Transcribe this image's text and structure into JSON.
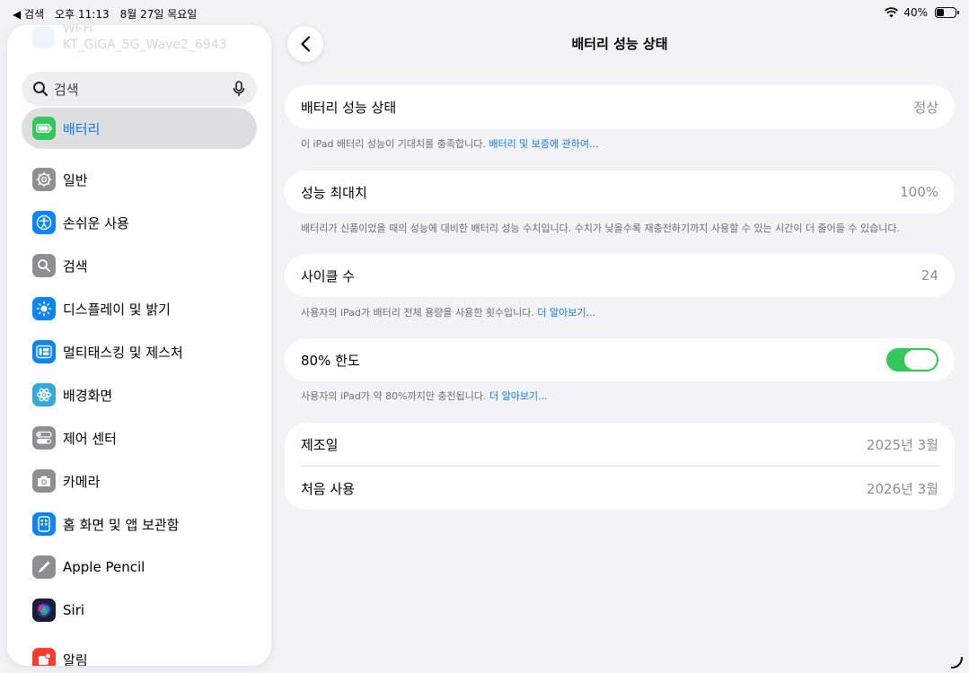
{
  "status_bar": {
    "back_app": "◀ 검색",
    "time": "오후 11:13",
    "date": "8월 27일 목요일",
    "battery_percent": "40%",
    "battery_level": 0.4
  },
  "sidebar": {
    "wifi_label": "Wi-Fi",
    "wifi_network": "KT_GiGA_5G_Wave2_6943",
    "search_placeholder": "검색",
    "selected_item": "배터리",
    "items": [
      {
        "label": "일반",
        "icon": "gear-icon",
        "color": "#8e8e93"
      },
      {
        "label": "손쉬운 사용",
        "icon": "accessibility-icon",
        "color": "#0a84ff"
      },
      {
        "label": "검색",
        "icon": "search-icon",
        "color": "#8e8e93"
      },
      {
        "label": "디스플레이 및 밝기",
        "icon": "brightness-icon",
        "color": "#0a84ff"
      },
      {
        "label": "멀티태스킹 및 제스처",
        "icon": "multitasking-icon",
        "color": "#0a84ff"
      },
      {
        "label": "배경화면",
        "icon": "wallpaper-icon",
        "color": "#34aadc"
      },
      {
        "label": "제어 센터",
        "icon": "control-center-icon",
        "color": "#8e8e93"
      },
      {
        "label": "카메라",
        "icon": "camera-icon",
        "color": "#8e8e93"
      },
      {
        "label": "홈 화면 및 앱 보관함",
        "icon": "home-screen-icon",
        "color": "#0a84ff"
      },
      {
        "label": "Apple Pencil",
        "icon": "pencil-icon",
        "color": "#8e8e93"
      },
      {
        "label": "Siri",
        "icon": "siri-icon",
        "color": "#1c1c3a"
      },
      {
        "label": "알림",
        "icon": "notifications-icon",
        "color": "#ff3b30"
      }
    ]
  },
  "main": {
    "title": "배터리 성능 상태",
    "health": {
      "label": "배터리 성능 상태",
      "value": "정상"
    },
    "health_footer": "이 iPad 배터리 성능이 기대치를 충족합니다.",
    "health_footer_link": "배터리 및 보증에 관하여...",
    "max_capacity": {
      "label": "성능 최대치",
      "value": "100%"
    },
    "max_capacity_footer": "배터리가 신품이었을 때의 성능에 대비한 배터리 성능 수치입니다. 수치가 낮을수록 재충전하기까지 사용할 수 있는 시간이 더 줄어들 수 있습니다.",
    "cycle_count": {
      "label": "사이클 수",
      "value": "24"
    },
    "cycle_footer": "사용자의 iPad가 배터리 전체 용량을 사용한 횟수입니다.",
    "cycle_footer_link": "더 알아보기...",
    "limit": {
      "label": "80% 한도",
      "enabled": true
    },
    "limit_footer": "사용자의 iPad가 약 80%까지만 충전됩니다.",
    "limit_footer_link": "더 알아보기...",
    "manufacture": {
      "label": "제조일",
      "value": "2025년 3월"
    },
    "first_use": {
      "label": "처음 사용",
      "value": "2026년 3월"
    }
  },
  "colors": {
    "accent": "#0a7aff",
    "toggle_on": "#34c759",
    "battery_green": "#34c759"
  }
}
